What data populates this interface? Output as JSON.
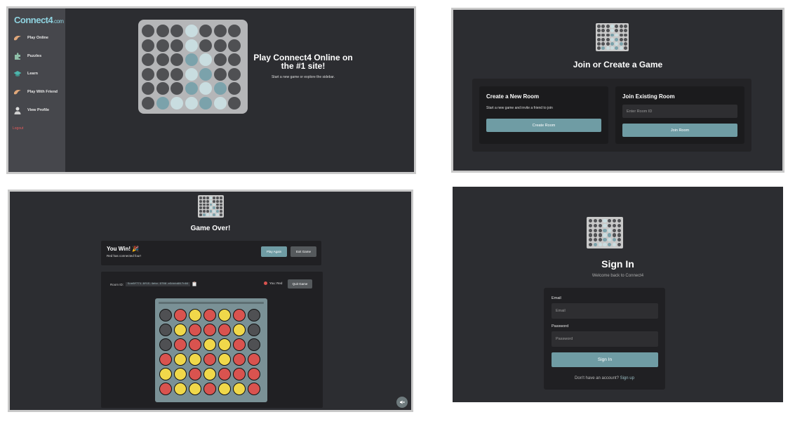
{
  "colors": {
    "panel_bg": "#2c2d31",
    "sidebar_bg": "#46474c",
    "accent_teal": "#6f9ca4",
    "logout_red": "#e35b5b",
    "piece_red": "#d9534f",
    "piece_yellow": "#f0d84a",
    "empty_dark": "#4f5053",
    "piece_light": "#c9dde0",
    "piece_teal": "#7ba2ab"
  },
  "home": {
    "logo_main": "Connect4",
    "logo_suffix": ".com",
    "sidebar": [
      {
        "label": "Play Online",
        "icon": "hand-wave-icon"
      },
      {
        "label": "Puzzles",
        "icon": "puzzle-icon"
      },
      {
        "label": "Learn",
        "icon": "graduation-cap-icon"
      },
      {
        "label": "Play With Friend",
        "icon": "hand-wave-icon"
      },
      {
        "label": "View Profile",
        "icon": "user-icon"
      }
    ],
    "logout": "Logout",
    "hero_title": "Play Connect4 Online on the #1 site!",
    "hero_subtitle": "Start a new game or explore the sidebar.",
    "board": [
      "DDDLDDD",
      "DDDLDDD",
      "DDDTLDD",
      "DDDLTDD",
      "DDDTLTD",
      "DTLLTLD"
    ]
  },
  "join": {
    "title": "Join or Create a Game",
    "create_title": "Create a New Room",
    "create_desc": "Start a new game and invite a friend to join",
    "create_button": "Create Room",
    "join_title": "Join Existing Room",
    "join_placeholder": "Enter Room ID",
    "join_button": "Join Room"
  },
  "gameover": {
    "title": "Game Over!",
    "win_title": "You Win! 🎉",
    "win_sub": "Red has connected four!",
    "play_again": "Play Again",
    "exit_game": "Exit Game",
    "room_label": "Room ID:",
    "room_id": "5ce8f771-6f15-4ebc-9786-e3dcbd817c84",
    "clipboard_icon": "clipboard-icon",
    "you_label": "You: Red",
    "quit_game": "Quit Game",
    "board": [
      "DRYRYRD",
      "DYRRRYD",
      "DRRYYRD",
      "RYYRYRR",
      "YYRYRRR",
      "RYYRYYR"
    ]
  },
  "signin": {
    "title": "Sign In",
    "subtitle": "Welcome back to Connect4",
    "email_label": "Email",
    "email_placeholder": "Email",
    "password_label": "Password",
    "password_placeholder": "Password",
    "submit": "Sign In",
    "footer_text": "Don't have an account?",
    "footer_link": "Sign up"
  }
}
